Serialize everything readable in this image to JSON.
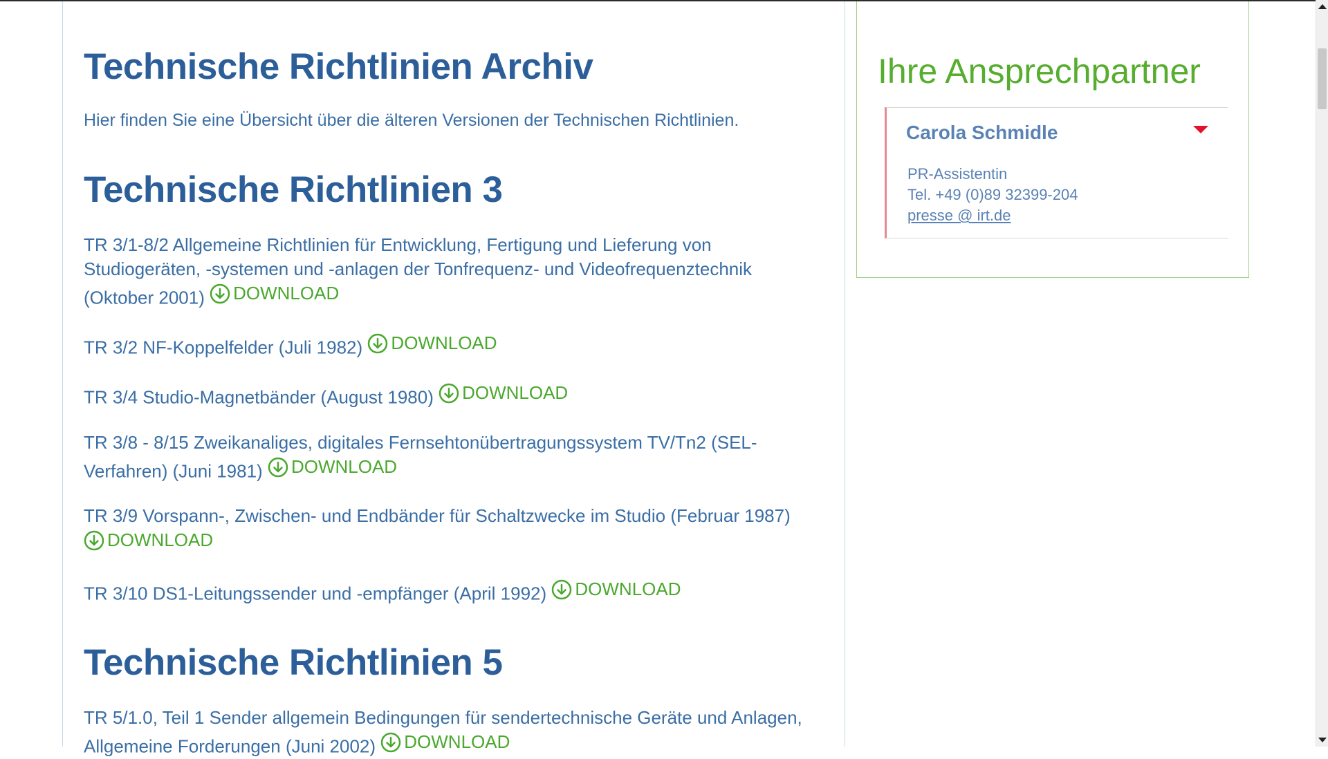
{
  "page": {
    "title": "Technische Richtlinien Archiv",
    "intro": "Hier finden Sie eine Übersicht über die älteren Versionen der Technischen Richtlinien."
  },
  "sections": [
    {
      "title": "Technische Richtlinien 3",
      "entries": [
        {
          "text": "TR 3/1-8/2 Allgemeine Richtlinien für Entwicklung, Fertigung und Lieferung von Studiogeräten, -systemen und -anlagen der Tonfrequenz- und Videofrequenztechnik (Oktober 2001)",
          "download": "DOWNLOAD"
        },
        {
          "text": "TR 3/2 NF-Koppelfelder (Juli 1982)",
          "download": "DOWNLOAD"
        },
        {
          "text": "TR 3/4 Studio-Magnetbänder (August 1980)",
          "download": "DOWNLOAD"
        },
        {
          "text": "TR 3/8 - 8/15 Zweikanaliges, digitales Fernsehtonübertragungssystem TV/Tn2 (SEL-Verfahren) (Juni 1981)",
          "download": "DOWNLOAD"
        },
        {
          "text": "TR 3/9 Vorspann-, Zwischen- und Endbänder für Schaltzwecke im Studio (Februar 1987)",
          "download": "DOWNLOAD"
        },
        {
          "text": "TR 3/10 DS1-Leitungssender und -empfänger (April 1992)",
          "download": "DOWNLOAD"
        }
      ]
    },
    {
      "title": "Technische Richtlinien 5",
      "entries": [
        {
          "text": "TR 5/1.0, Teil 1 Sender allgemein Bedingungen für sendertechnische Geräte und Anlagen, Allgemeine Forderungen (Juni 2002)",
          "download": "DOWNLOAD"
        }
      ]
    }
  ],
  "sidebar": {
    "title": "Ihre Ansprechpartner",
    "contact": {
      "name": "Carola Schmidle",
      "role": "PR-Assistentin",
      "tel": "Tel. +49 (0)89 32399-204",
      "email": "presse @ irt.de"
    }
  },
  "icons": {
    "download": "download-circle-icon",
    "toggle": "caret-down-icon"
  },
  "colors": {
    "heading": "#2c5f99",
    "text": "#3a6ea5",
    "download": "#4aa82e",
    "sidebar_title": "#56ad2e",
    "toggle": "#e3122a",
    "contact_border": "#e5898f"
  }
}
